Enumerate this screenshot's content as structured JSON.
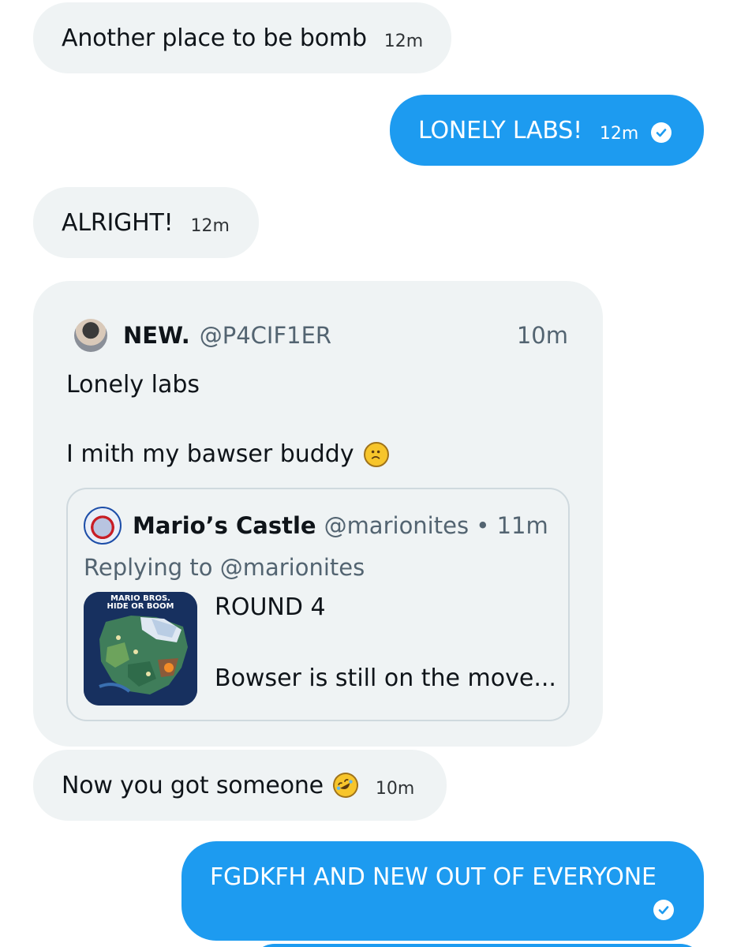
{
  "messages": [
    {
      "text": "Another place to be bomb",
      "time": "12m"
    },
    {
      "text": "LONELY LABS!",
      "time": "12m"
    },
    {
      "text": "ALRIGHT!",
      "time": "12m"
    },
    {
      "text": "Now you got someone",
      "time": "10m"
    },
    {
      "text": "FGDKFH AND NEW OUT OF EVERYONE"
    }
  ],
  "quoted_tweet": {
    "name": "NEW.",
    "handle": "@P4CIF1ER",
    "time": "10m",
    "line1": "Lonely labs",
    "line2": "I mith my bawser buddy",
    "inner": {
      "name": "Mario’s Castle",
      "handle_time": "@marionites • 11m",
      "replying_to": "Replying to @marionites",
      "thumb_title_1": "MARIO BROS.",
      "thumb_title_2": "HIDE OR BOOM",
      "line1": "ROUND 4",
      "line2": "Bowser is still on the move..."
    }
  },
  "icons": {
    "read_receipt": "check-circle-icon",
    "sad_emoji": "frowning-face-emoji",
    "laugh_emoji": "rolling-on-floor-laughing-emoji"
  },
  "colors": {
    "outgoing_bubble": "#1d9bf0",
    "incoming_bubble": "#eff3f4",
    "secondary_text": "#536471"
  }
}
